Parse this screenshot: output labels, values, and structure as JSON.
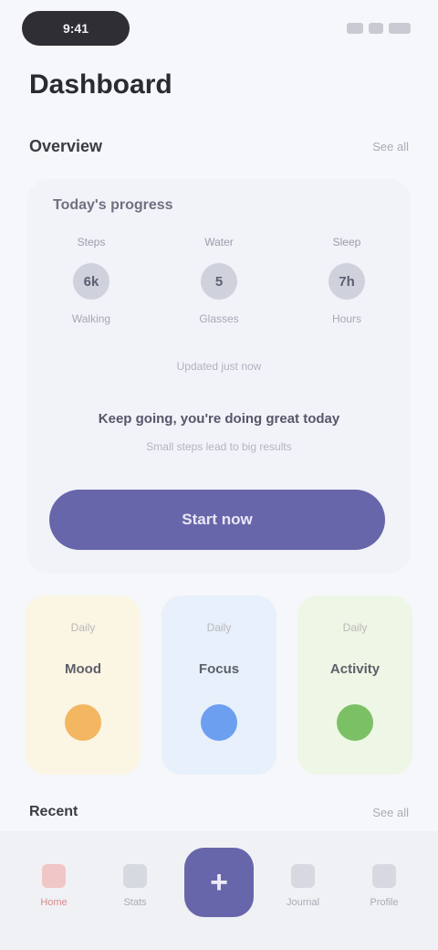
{
  "status_bar": {
    "time": "9:41"
  },
  "header": {
    "title": "Dashboard"
  },
  "section": {
    "title": "Overview",
    "link": "See all"
  },
  "card": {
    "label": "Today's progress",
    "stats": [
      {
        "caption": "Steps",
        "value": "6k",
        "sub": "Walking"
      },
      {
        "caption": "Water",
        "value": "5",
        "sub": "Glasses"
      },
      {
        "caption": "Sleep",
        "value": "7h",
        "sub": "Hours"
      }
    ],
    "hint": "Updated just now",
    "quote": "Keep going, you're doing great today",
    "quote_sub": "Small steps lead to big results",
    "button_label": "Start now"
  },
  "tiles": [
    {
      "caption": "Daily",
      "name": "Mood",
      "color": "#f3b661"
    },
    {
      "caption": "Daily",
      "name": "Focus",
      "color": "#6c9ff0"
    },
    {
      "caption": "Daily",
      "name": "Activity",
      "color": "#7cc066"
    }
  ],
  "section2": {
    "title": "Recent",
    "link": "See all"
  },
  "tabbar": {
    "items": [
      {
        "label": "Home",
        "icon": "home-icon"
      },
      {
        "label": "Stats",
        "icon": "chart-icon"
      },
      {
        "label": "",
        "icon": "plus-icon",
        "glyph": "+"
      },
      {
        "label": "Journal",
        "icon": "book-icon"
      },
      {
        "label": "Profile",
        "icon": "user-icon"
      }
    ]
  },
  "colors": {
    "accent": "#6866aa",
    "background": "#f6f7fa"
  }
}
